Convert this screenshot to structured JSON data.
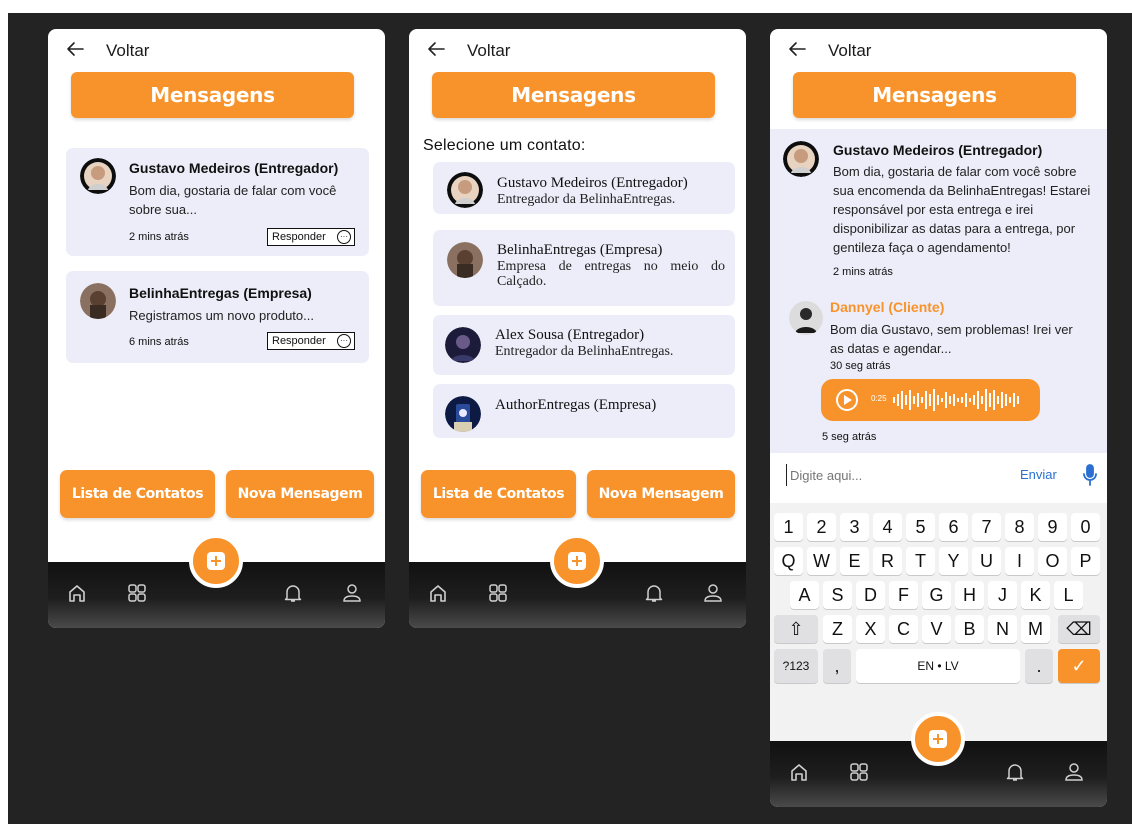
{
  "common": {
    "back_label": "Voltar",
    "title": "Mensagens",
    "contacts_button": "Lista de Contatos",
    "new_message_button": "Nova Mensagem",
    "accent_color": "#f8932b",
    "nav_icons": [
      "home-icon",
      "grid-icon",
      "add-icon",
      "bell-icon",
      "user-icon"
    ]
  },
  "screen1": {
    "messages": [
      {
        "name": "Gustavo Medeiros (Entregador)",
        "line1": "Bom dia, gostaria de falar com você",
        "line2": "sobre sua...",
        "time": "2 mins atrás",
        "reply": "Responder"
      },
      {
        "name": "BelinhaEntregas (Empresa)",
        "line1": "Registramos um novo produto...",
        "time": "6 mins atrás",
        "reply": "Responder"
      }
    ]
  },
  "screen2": {
    "select_label": "Selecione um contato:",
    "contacts": [
      {
        "name": "Gustavo Medeiros (Entregador)",
        "desc": "Entregador da BelinhaEntregas."
      },
      {
        "name": "BelinhaEntregas (Empresa)",
        "desc": "Empresa de entregas no meio do Calçado."
      },
      {
        "name": "Alex Sousa (Entregador)",
        "desc": "Entregador da BelinhaEntregas."
      },
      {
        "name": "AuthorEntregas (Empresa)",
        "desc": ""
      }
    ]
  },
  "screen3": {
    "chat": [
      {
        "name": "Gustavo Medeiros (Entregador)",
        "lines": [
          "Bom dia, gostaria de falar com você sobre",
          "sua encomenda da BelinhaEntregas! Estarei",
          "responsável por esta entrega e  irei",
          "disponibilizar as datas para a entrega, por",
          "gentileza faça o agendamento!"
        ],
        "time": "2 mins atrás"
      },
      {
        "name": "Dannyel (Cliente)",
        "lines": [
          "Bom dia Gustavo, sem problemas! Irei ver",
          "as datas e agendar..."
        ],
        "time": "30 seg atrás"
      }
    ],
    "audio": {
      "duration": "0:25",
      "time": "5 seg atrás"
    },
    "input_placeholder": "Digite aqui...",
    "send_label": "Enviar",
    "keyboard": {
      "row1": [
        "1",
        "2",
        "3",
        "4",
        "5",
        "6",
        "7",
        "8",
        "9",
        "0"
      ],
      "row2": [
        "Q",
        "W",
        "E",
        "R",
        "T",
        "Y",
        "U",
        "I",
        "O",
        "P"
      ],
      "row3": [
        "A",
        "S",
        "D",
        "F",
        "G",
        "H",
        "J",
        "K",
        "L"
      ],
      "row4": [
        "Z",
        "X",
        "C",
        "V",
        "B",
        "N",
        "M"
      ],
      "numbers_key": "?123",
      "comma_key": ",",
      "space_key": "EN • LV",
      "period_key": ".",
      "shift_key": "⇧",
      "backspace_key": "⌫",
      "enter_key": "✓"
    }
  }
}
